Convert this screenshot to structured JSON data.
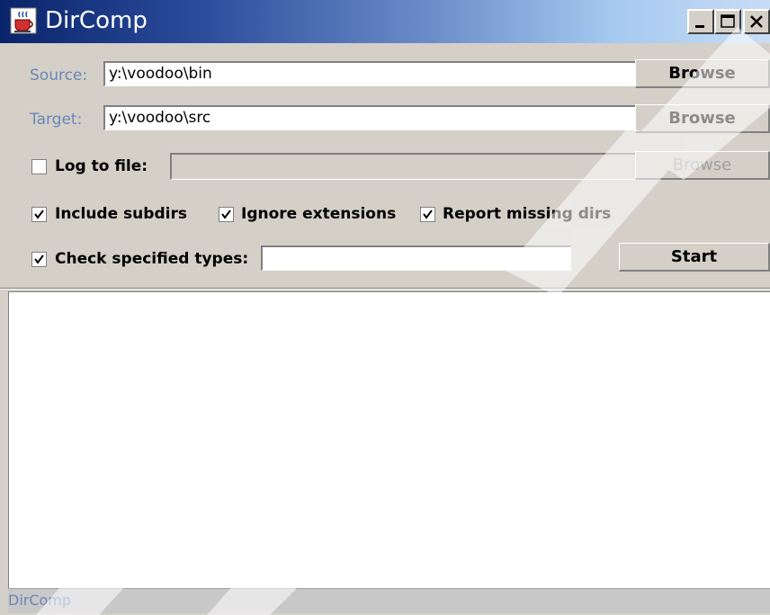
{
  "window": {
    "title": "DirComp",
    "controls": {
      "minimize": "minimize",
      "maximize": "maximize",
      "close": "close"
    }
  },
  "source": {
    "label": "Source:",
    "value": "y:\\voodoo\\bin",
    "browse": "Browse"
  },
  "target": {
    "label": "Target:",
    "value": "y:\\voodoo\\src",
    "browse": "Browse"
  },
  "log": {
    "label": "Log to file:",
    "checked": false,
    "value": "",
    "browse": "Browse",
    "enabled": false
  },
  "options": {
    "include_subdirs": {
      "label": "Include subdirs",
      "checked": true
    },
    "ignore_extensions": {
      "label": "Ignore extensions",
      "checked": true
    },
    "report_missing": {
      "label": "Report missing dirs",
      "checked": true
    }
  },
  "types": {
    "label": "Check specified types:",
    "checked": true,
    "value": ""
  },
  "start_button": "Start",
  "output_text": "",
  "status": "DirComp",
  "icons": {
    "app": "java-cup-icon",
    "minimize": "minimize-icon",
    "maximize": "maximize-icon",
    "close": "close-icon",
    "check": "checkmark-icon"
  },
  "colors": {
    "titlebar_start": "#0a246a",
    "titlebar_end": "#c8dcf4",
    "face": "#d4d0c8",
    "label_blue": "#6a86b8"
  }
}
